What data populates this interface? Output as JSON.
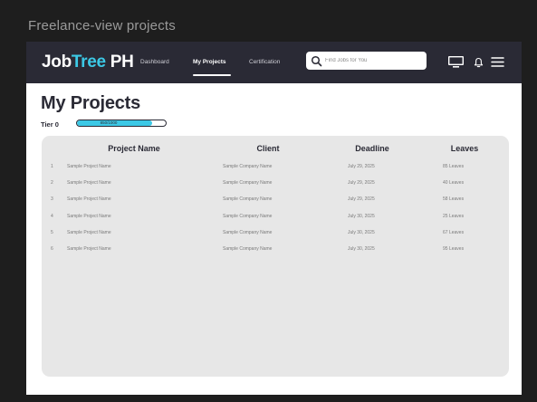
{
  "frame_title": "Freelance-view projects",
  "colors": {
    "navbar": "#2a2a35",
    "accent": "#3cc9e6",
    "panel": "#e7e7e7"
  },
  "navbar": {
    "logo_part1": "Job",
    "logo_part2": "Tree",
    "logo_part3": " PH",
    "links": [
      "Dashboard",
      "My Projects",
      "Certification"
    ],
    "active_link": "My Projects",
    "search_placeholder": "Find Jobs for You",
    "icons": [
      "search-icon",
      "monitor-icon",
      "bell-icon",
      "menu-icon"
    ]
  },
  "page": {
    "title": "My Projects",
    "tier_label": "Tier 0",
    "tier_progress_text": "850/1000",
    "tier_progress_fraction": 0.85
  },
  "table": {
    "headers": [
      "Project Name",
      "Client",
      "Deadline",
      "Leaves"
    ],
    "rows": [
      {
        "index": "1",
        "project": "Sample Project Name",
        "client": "Sample Company Name",
        "deadline": "July 29, 2025",
        "leaves": "85 Leaves"
      },
      {
        "index": "2",
        "project": "Sample Project Name",
        "client": "Sample Company Name",
        "deadline": "July 29, 2025",
        "leaves": "40 Leaves"
      },
      {
        "index": "3",
        "project": "Sample Project Name",
        "client": "Sample Company Name",
        "deadline": "July 29, 2025",
        "leaves": "58 Leaves"
      },
      {
        "index": "4",
        "project": "Sample Project Name",
        "client": "Sample Company Name",
        "deadline": "July 30, 2025",
        "leaves": "25 Leaves"
      },
      {
        "index": "5",
        "project": "Sample Project Name",
        "client": "Sample Company Name",
        "deadline": "July 30, 2025",
        "leaves": "67 Leaves"
      },
      {
        "index": "6",
        "project": "Sample Project Name",
        "client": "Sample Company Name",
        "deadline": "July 30, 2025",
        "leaves": "95 Leaves"
      }
    ]
  }
}
